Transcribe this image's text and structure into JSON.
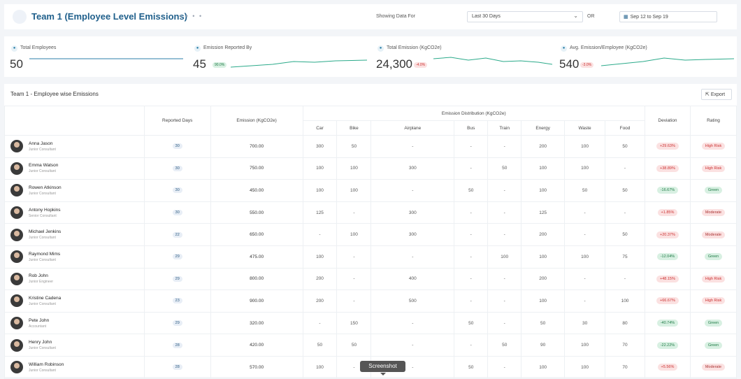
{
  "header": {
    "title": "Team 1 (Employee Level Emissions)",
    "showing_label": "Showing Data For",
    "range_value": "Last 30 Days",
    "or_label": "OR",
    "date_range": "Sep 12 to Sep 19"
  },
  "stats": [
    {
      "label": "Total Employees",
      "value": "50",
      "badge": ""
    },
    {
      "label": "Emission Reported By",
      "value": "45",
      "badge": "90.0%"
    },
    {
      "label": "Total Emission (KgCO2e)",
      "value": "24,300",
      "badge": "-4.0%"
    },
    {
      "label": "Avg. Emission/Employee (KgCO2e)",
      "value": "540",
      "badge": "-3.0%"
    }
  ],
  "panel": {
    "title": "Team 1 - Employee wise Emissions",
    "export_label": "Export"
  },
  "table": {
    "headers": {
      "reported_days": "Reported Days",
      "emission": "Emission (KgCO2e)",
      "distribution": "Emission Distribution (KgCO2e)",
      "deviation": "Deviation",
      "rating": "Rating",
      "car": "Car",
      "bike": "Bike",
      "airplane": "Airplane",
      "bus": "Bus",
      "train": "Train",
      "energy": "Energy",
      "waste": "Waste",
      "food": "Food"
    },
    "rows": [
      {
        "name": "Anna Jason",
        "role": "Junior Consultant",
        "days": "30",
        "emission": "700.00",
        "car": "300",
        "bike": "50",
        "airplane": "-",
        "bus": "-",
        "train": "-",
        "energy": "200",
        "waste": "100",
        "food": "50",
        "deviation": "+29.63%",
        "rating": "High Risk"
      },
      {
        "name": "Emma Watson",
        "role": "Junior Consultant",
        "days": "30",
        "emission": "750.00",
        "car": "100",
        "bike": "100",
        "airplane": "300",
        "bus": "-",
        "train": "50",
        "energy": "100",
        "waste": "100",
        "food": "-",
        "deviation": "+38.89%",
        "rating": "High Risk"
      },
      {
        "name": "Rowen Atkinson",
        "role": "Junior Consultant",
        "days": "30",
        "emission": "450.00",
        "car": "100",
        "bike": "100",
        "airplane": "-",
        "bus": "50",
        "train": "-",
        "energy": "100",
        "waste": "50",
        "food": "50",
        "deviation": "-16.67%",
        "rating": "Green"
      },
      {
        "name": "Antony Hopkins",
        "role": "Senior Consultant",
        "days": "30",
        "emission": "550.00",
        "car": "125",
        "bike": "-",
        "airplane": "300",
        "bus": "-",
        "train": "-",
        "energy": "125",
        "waste": "-",
        "food": "-",
        "deviation": "+1.85%",
        "rating": "Moderate"
      },
      {
        "name": "Michael Jenkins",
        "role": "Junior Consultant",
        "days": "22",
        "emission": "650.00",
        "car": "-",
        "bike": "100",
        "airplane": "300",
        "bus": "-",
        "train": "-",
        "energy": "200",
        "waste": "-",
        "food": "50",
        "deviation": "+20.37%",
        "rating": "Moderate"
      },
      {
        "name": "Raymond Mims",
        "role": "Junior Consultant",
        "days": "29",
        "emission": "475.00",
        "car": "100",
        "bike": "-",
        "airplane": "-",
        "bus": "-",
        "train": "100",
        "energy": "100",
        "waste": "100",
        "food": "75",
        "deviation": "-12.04%",
        "rating": "Green"
      },
      {
        "name": "Rob John",
        "role": "Junior Engineer",
        "days": "29",
        "emission": "800.00",
        "car": "200",
        "bike": "-",
        "airplane": "400",
        "bus": "-",
        "train": "-",
        "energy": "200",
        "waste": "-",
        "food": "-",
        "deviation": "+48.15%",
        "rating": "High Risk"
      },
      {
        "name": "Kristine Cadena",
        "role": "Junior Consultant",
        "days": "23",
        "emission": "900.00",
        "car": "200",
        "bike": "-",
        "airplane": "500",
        "bus": "-",
        "train": "-",
        "energy": "100",
        "waste": "-",
        "food": "100",
        "deviation": "+66.67%",
        "rating": "High Risk"
      },
      {
        "name": "Pete John",
        "role": "Accountant",
        "days": "29",
        "emission": "320.00",
        "car": "-",
        "bike": "150",
        "airplane": "-",
        "bus": "50",
        "train": "-",
        "energy": "50",
        "waste": "30",
        "food": "80",
        "deviation": "-40.74%",
        "rating": "Green"
      },
      {
        "name": "Henry John",
        "role": "Junior Consultant",
        "days": "28",
        "emission": "420.00",
        "car": "50",
        "bike": "50",
        "airplane": "-",
        "bus": "-",
        "train": "50",
        "energy": "90",
        "waste": "100",
        "food": "70",
        "deviation": "-22.22%",
        "rating": "Green"
      },
      {
        "name": "William Robinson",
        "role": "Junior Consultant",
        "days": "28",
        "emission": "570.00",
        "car": "100",
        "bike": "-",
        "airplane": "-",
        "bus": "50",
        "train": "-",
        "energy": "100",
        "waste": "100",
        "food": "70",
        "deviation": "+5.56%",
        "rating": "Moderate"
      }
    ]
  },
  "tooltip": "Screenshot",
  "colors": {
    "brand": "#1f5f8b",
    "high_risk": "#c33",
    "green": "#1e7a45"
  }
}
